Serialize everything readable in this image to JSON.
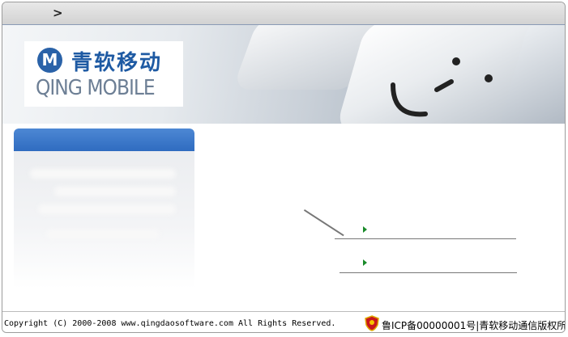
{
  "topbar": {
    "nav_glyph": ">"
  },
  "logo": {
    "badge_letter": "M",
    "cn": "青软移动",
    "en": "QING MOBILE",
    "brand_color": "#1e5aa3"
  },
  "panel": {
    "header_color": "#2f6cc0"
  },
  "links": {
    "bullet_icon": "green-triangle-icon"
  },
  "footer": {
    "copyright": "Copyright (C) 2000-2008 www.qingdaosoftware.com All Rights Reserved.",
    "icp": "鲁ICP备00000001号|青软移动通信版权所有",
    "badge_icon": "police-shield-icon"
  }
}
